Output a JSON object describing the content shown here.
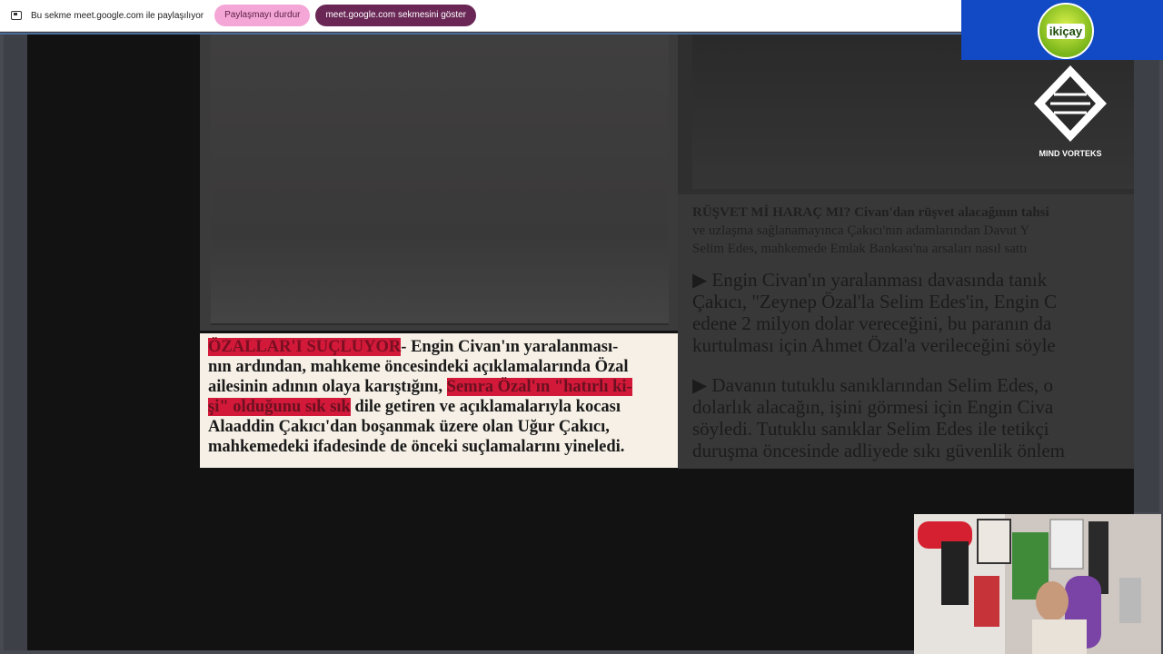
{
  "share_bar": {
    "text": "Bu sekme meet.google.com ile paylaşılıyor",
    "stop_label": "Paylaşmayı durdur",
    "show_tab_label": "meet.google.com sekmesini göster"
  },
  "article": {
    "headline": "ÖZALLAR'I SUÇLUYOR",
    "line1_rest": "- Engin Civan'ın yaralanması-",
    "line2": "nın ardından, mahkeme öncesindeki açıklamalarında Özal",
    "line3_a": "ailesinin adının olaya karıştığını, ",
    "line3_hl": "Semra Özal'ın \"hatırlı ki-",
    "line4_hl": "şi\" olduğunu sık sık",
    "line4_rest": " dile getiren ve açıklamalarıyla kocası",
    "line5": "Alaaddin Çakıcı'dan boşanmak üzere olan Uğur Çakıcı,",
    "line6": "mahkemedeki ifadesinde de önceki suçlamalarını yineledi."
  },
  "right_article": {
    "lead1": "RÜŞVET Mİ HARAÇ MI? Civan'dan rüşvet alacağının tahsi",
    "lead2": "ve uzlaşma sağlanamayınca Çakıcı'nın adamlarından Davut Y",
    "lead3": "Selim Edes, mahkemede Emlak Bankası'na arsaları nasıl sattı",
    "p1": "▶ Engin Civan'ın yaralanması davasında tanık",
    "p2": "Çakıcı, \"Zeynep Özal'la Selim Edes'in, Engin C",
    "p3": "edene 2 milyon dolar vereceğini, bu paranın da",
    "p4": "kurtulması için Ahmet Özal'a verileceğini söyle",
    "p5": "▶ Davanın tutuklu sanıklarından Selim Edes, o",
    "p6": "dolarlık alacağın, işini görmesi için Engin Civa",
    "p7": "söyledi. Tutuklu sanıklar Selim Edes ile tetikçi",
    "p8": "duruşma öncesinde adliyede sıkı güvenlik önlem"
  },
  "logos": {
    "ikicay": "ikiçay",
    "mind_vorteks": "MIND VORTEKS"
  },
  "colors": {
    "highlight": "#d21939",
    "stop_button": "#f4a6d6",
    "show_button": "#6a2756",
    "logo_bg": "#1249c4"
  }
}
